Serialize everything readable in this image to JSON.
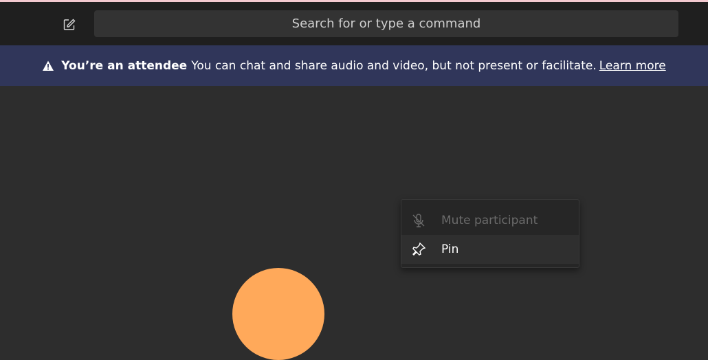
{
  "colors": {
    "page_bg": "#2d2d2d",
    "top_accent": "#f2c9cf",
    "banner_bg": "#30365a",
    "avatar": "#ffa95a"
  },
  "toolbar": {
    "compose_icon": "compose-icon",
    "search_placeholder": "Search for or type a command"
  },
  "banner": {
    "icon": "warning-icon",
    "title": "You’re an attendee",
    "message": "You can chat and share audio and video, but not present or facilitate.",
    "link": "Learn more"
  },
  "context_menu": {
    "items": [
      {
        "label": "Mute participant",
        "icon": "mic-off-icon",
        "enabled": false
      },
      {
        "label": "Pin",
        "icon": "pin-icon",
        "enabled": true
      }
    ]
  }
}
